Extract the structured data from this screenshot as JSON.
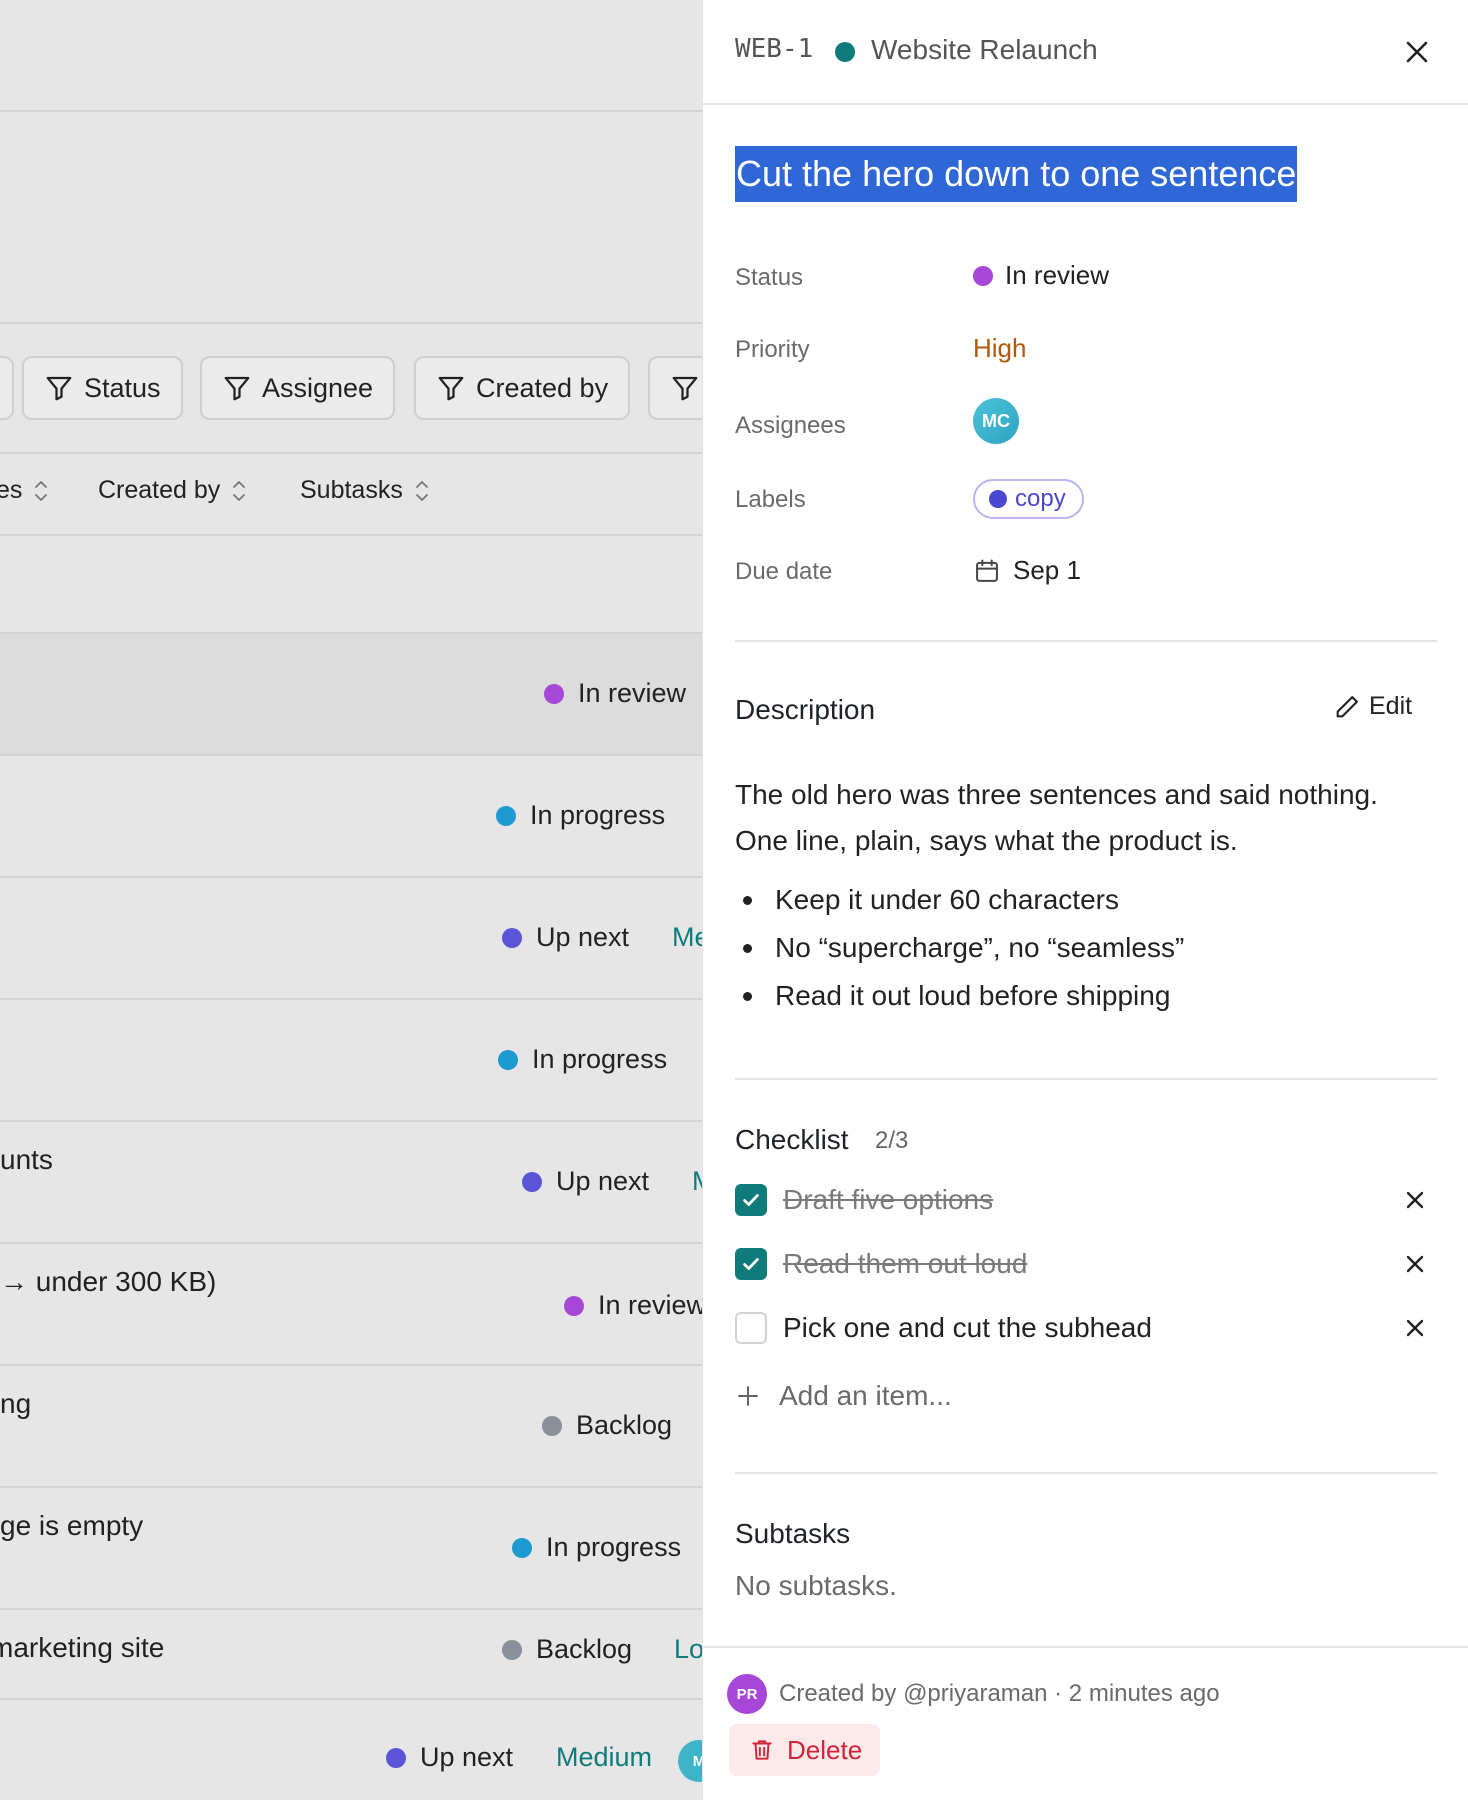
{
  "background": {
    "filters": [
      {
        "label": ""
      },
      {
        "label": "Status"
      },
      {
        "label": "Assignee"
      },
      {
        "label": "Created by"
      },
      {
        "label": ""
      }
    ],
    "columns": [
      {
        "label": "es"
      },
      {
        "label": "Created by"
      },
      {
        "label": "Subtasks"
      }
    ],
    "rows": [
      {
        "title": "",
        "status": "In review",
        "status_color": "#a647d8",
        "priority": "",
        "highlighted": true
      },
      {
        "title": "",
        "status": "In progress",
        "status_color": "#1d9bd1",
        "priority": ""
      },
      {
        "title": "",
        "status": "Up next",
        "status_color": "#5a55d6",
        "priority": "Me"
      },
      {
        "title": "",
        "status": "In progress",
        "status_color": "#1d9bd1",
        "priority": ""
      },
      {
        "title": "unts",
        "status": "Up next",
        "status_color": "#5a55d6",
        "priority": "M"
      },
      {
        "title": "→ under 300 KB)",
        "status": "In review",
        "status_color": "#a647d8",
        "priority": ""
      },
      {
        "title": "ng",
        "status": "Backlog",
        "status_color": "#8a9099",
        "priority": ""
      },
      {
        "title": "ge is empty",
        "status": "In progress",
        "status_color": "#1d9bd1",
        "priority": ""
      },
      {
        "title": "marketing site",
        "status": "Backlog",
        "status_color": "#8a9099",
        "priority": "Lo"
      },
      {
        "title": "",
        "status": "Up next",
        "status_color": "#5a55d6",
        "priority": "Medium",
        "avatar": "M"
      }
    ]
  },
  "panel": {
    "task_key": "WEB-1",
    "project": {
      "name": "Website Relaunch",
      "color": "#0f7b7b"
    },
    "title": "Cut the hero down to one sentence",
    "properties": {
      "status_label": "Status",
      "status_value": "In review",
      "status_color": "#a647d8",
      "priority_label": "Priority",
      "priority_value": "High",
      "priority_color": "#b3590b",
      "assignees_label": "Assignees",
      "assignee_initials": "MC",
      "labels_label": "Labels",
      "label_value": "copy",
      "due_label": "Due date",
      "due_value": "Sep 1"
    },
    "description": {
      "title": "Description",
      "edit_label": "Edit",
      "paragraph": "The old hero was three sentences and said nothing. One line, plain, says what the product is.",
      "bullets": [
        "Keep it under 60 characters",
        "No “supercharge”, no “seamless”",
        "Read it out loud before shipping"
      ]
    },
    "checklist": {
      "title": "Checklist",
      "count": "2/3",
      "items": [
        {
          "text": "Draft five options",
          "done": true
        },
        {
          "text": "Read them out loud",
          "done": true
        },
        {
          "text": "Pick one and cut the subhead",
          "done": false
        }
      ],
      "add_placeholder": "Add an item..."
    },
    "subtasks": {
      "title": "Subtasks",
      "empty": "No subtasks."
    },
    "footer": {
      "creator_initials": "PR",
      "created_text": "Created by @priyaraman · 2 minutes ago",
      "delete_label": "Delete"
    }
  }
}
